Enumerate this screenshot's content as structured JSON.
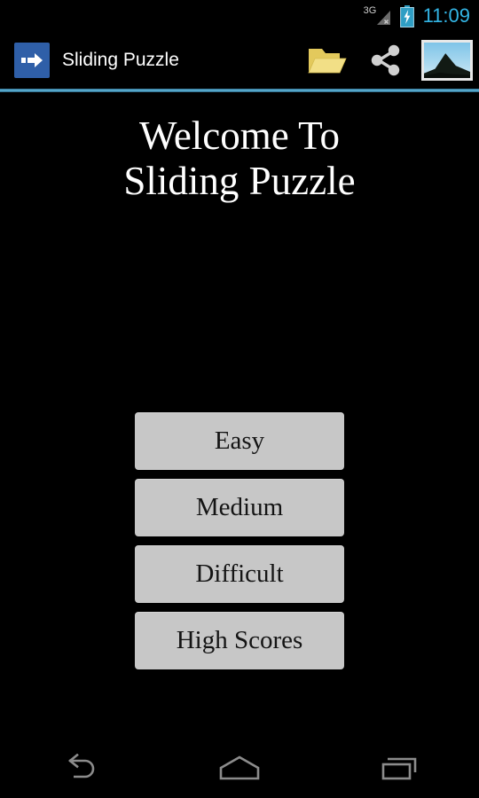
{
  "status_bar": {
    "network_label": "3G",
    "signal_state": "no-service",
    "battery_state": "charging",
    "time": "11:09",
    "time_color": "#33b5e5"
  },
  "action_bar": {
    "app_title": "Sliding Puzzle",
    "app_icon": "arrow-right-icon",
    "app_icon_color": "#2f5fa8",
    "actions": [
      {
        "name": "open-folder-icon",
        "label": "Open",
        "color": "#ead06a"
      },
      {
        "name": "share-icon",
        "label": "Share",
        "color": "#d0d0d0"
      },
      {
        "name": "image-thumbnail",
        "label": "Pick Image",
        "color": "#e8e8e8"
      }
    ],
    "divider_color": "#5fb0d4"
  },
  "main": {
    "title_line1": "Welcome To",
    "title_line2": "Sliding Puzzle",
    "title_color": "#ffffff",
    "buttons": [
      {
        "label": "Easy",
        "name": "difficulty-easy-button"
      },
      {
        "label": "Medium",
        "name": "difficulty-medium-button"
      },
      {
        "label": "Difficult",
        "name": "difficulty-difficult-button"
      },
      {
        "label": "High Scores",
        "name": "high-scores-button"
      }
    ],
    "button_color": "#c7c7c7",
    "button_text_color": "#141414",
    "background_color": "#000000"
  },
  "nav_bar": {
    "buttons": [
      {
        "name": "nav-back-icon",
        "label": "Back"
      },
      {
        "name": "nav-home-icon",
        "label": "Home"
      },
      {
        "name": "nav-recents-icon",
        "label": "Recent Apps"
      }
    ],
    "icon_color": "#8c8c8c"
  }
}
